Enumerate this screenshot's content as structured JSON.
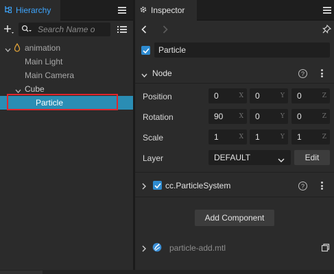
{
  "hierarchy": {
    "tab_label": "Hierarchy",
    "tab_icon": "hierarchy-icon",
    "search_placeholder": "Search Name o",
    "tree": [
      {
        "label": "animation",
        "icon": "prefab-drop-icon",
        "expanded": true
      },
      {
        "label": "Main Light"
      },
      {
        "label": "Main Camera"
      },
      {
        "label": "Cube",
        "expanded": true
      },
      {
        "label": "Particle",
        "selected": true
      }
    ]
  },
  "inspector": {
    "tab_label": "Inspector",
    "tab_icon": "gear-icon",
    "node_name": "Particle",
    "node_active": true,
    "node_section": {
      "title": "Node",
      "position": {
        "label": "Position",
        "x": "0",
        "y": "0",
        "z": "0"
      },
      "rotation": {
        "label": "Rotation",
        "x": "90",
        "y": "0",
        "z": "0"
      },
      "scale": {
        "label": "Scale",
        "x": "1",
        "y": "1",
        "z": "1"
      },
      "layer": {
        "label": "Layer",
        "value": "DEFAULT",
        "edit_label": "Edit"
      },
      "axis_labels": {
        "x": "X",
        "y": "Y",
        "z": "Z"
      }
    },
    "component": {
      "name": "cc.ParticleSystem",
      "enabled": true
    },
    "add_component_label": "Add Component",
    "material": {
      "name": "particle-add.mtl"
    }
  },
  "colors": {
    "accent": "#3ea6ff",
    "selection": "#2a8db4",
    "checkbox": "#2e8bd0",
    "highlight_outline": "#e0262c",
    "panel_bg": "#2b2b2b",
    "field_bg": "#1f1f1f"
  }
}
